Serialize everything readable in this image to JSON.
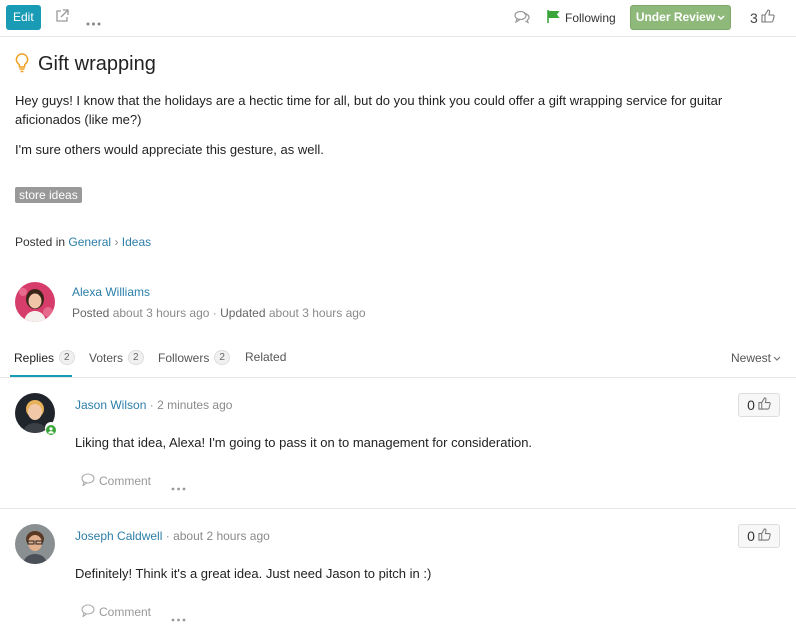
{
  "toolbar": {
    "edit_label": "Edit",
    "following_label": "Following",
    "status_label": "Under Review",
    "vote_count": "3",
    "icons": {
      "external": "external-link-icon",
      "more": "more-dots-icon",
      "comments": "comments-icon",
      "flag": "flag-icon",
      "thumb": "thumbs-up-icon"
    }
  },
  "post": {
    "title": "Gift wrapping",
    "paragraph1": "Hey guys! I know that the holidays are a hectic time for all, but do you think you could offer a gift wrapping service for guitar aficionados (like me?)",
    "paragraph2": "I'm sure others would appreciate this gesture, as well.",
    "tag": "store ideas",
    "posted_in_label": "Posted in",
    "category": "General",
    "breadcrumb_sep": "›",
    "subcategory": "Ideas",
    "author": "Alexa Williams",
    "posted_label": "Posted",
    "posted_time": "about 3 hours ago",
    "meta_sep": "·",
    "updated_label": "Updated",
    "updated_time": "about 3 hours ago"
  },
  "tabs": {
    "replies": {
      "label": "Replies",
      "count": "2"
    },
    "voters": {
      "label": "Voters",
      "count": "2"
    },
    "followers": {
      "label": "Followers",
      "count": "2"
    },
    "related": {
      "label": "Related"
    },
    "sort_label": "Newest"
  },
  "replies": [
    {
      "author": "Jason Wilson",
      "sep": "·",
      "time": "2 minutes ago",
      "text": "Liking that idea, Alexa! I'm going to pass it on to management for consideration.",
      "comment_label": "Comment",
      "votes": "0"
    },
    {
      "author": "Joseph Caldwell",
      "sep": "·",
      "time": "about 2 hours ago",
      "text": "Definitely! Think it's a great idea. Just need Jason to pitch in :)",
      "comment_label": "Comment",
      "votes": "0"
    }
  ],
  "colors": {
    "accent": "#1a9bb5",
    "status": "#8fb97a",
    "link": "#2c7ea8",
    "flag": "#3aa63a",
    "idea": "#f0a020"
  }
}
